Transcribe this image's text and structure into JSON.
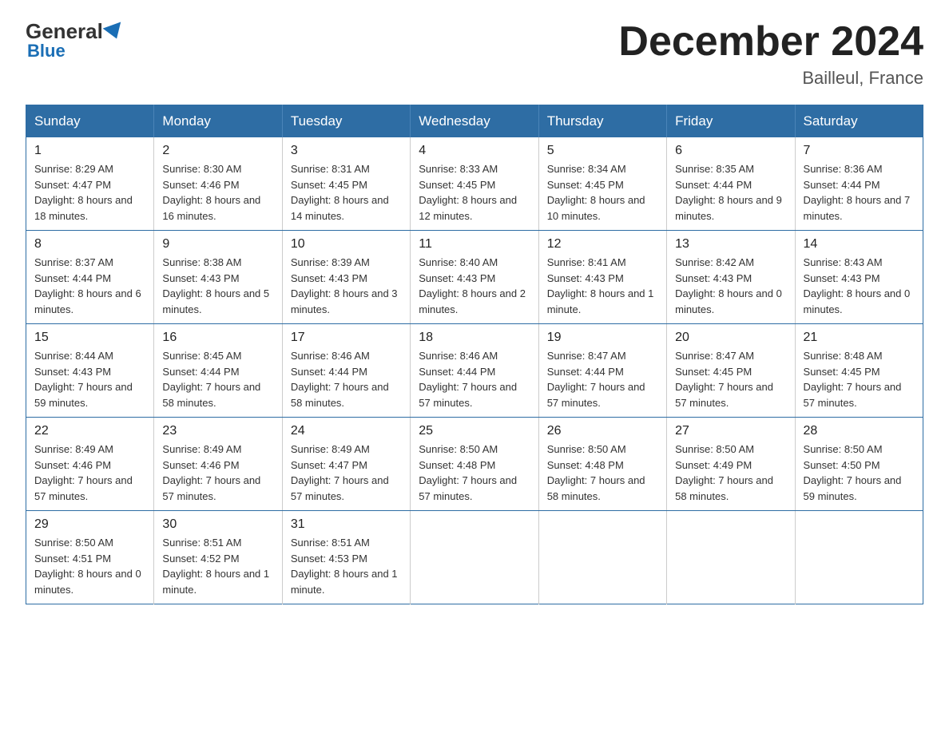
{
  "logo": {
    "general": "General",
    "blue": "Blue"
  },
  "title": "December 2024",
  "location": "Bailleul, France",
  "days_header": [
    "Sunday",
    "Monday",
    "Tuesday",
    "Wednesday",
    "Thursday",
    "Friday",
    "Saturday"
  ],
  "weeks": [
    [
      {
        "day": "1",
        "sunrise": "8:29 AM",
        "sunset": "4:47 PM",
        "daylight": "8 hours and 18 minutes."
      },
      {
        "day": "2",
        "sunrise": "8:30 AM",
        "sunset": "4:46 PM",
        "daylight": "8 hours and 16 minutes."
      },
      {
        "day": "3",
        "sunrise": "8:31 AM",
        "sunset": "4:45 PM",
        "daylight": "8 hours and 14 minutes."
      },
      {
        "day": "4",
        "sunrise": "8:33 AM",
        "sunset": "4:45 PM",
        "daylight": "8 hours and 12 minutes."
      },
      {
        "day": "5",
        "sunrise": "8:34 AM",
        "sunset": "4:45 PM",
        "daylight": "8 hours and 10 minutes."
      },
      {
        "day": "6",
        "sunrise": "8:35 AM",
        "sunset": "4:44 PM",
        "daylight": "8 hours and 9 minutes."
      },
      {
        "day": "7",
        "sunrise": "8:36 AM",
        "sunset": "4:44 PM",
        "daylight": "8 hours and 7 minutes."
      }
    ],
    [
      {
        "day": "8",
        "sunrise": "8:37 AM",
        "sunset": "4:44 PM",
        "daylight": "8 hours and 6 minutes."
      },
      {
        "day": "9",
        "sunrise": "8:38 AM",
        "sunset": "4:43 PM",
        "daylight": "8 hours and 5 minutes."
      },
      {
        "day": "10",
        "sunrise": "8:39 AM",
        "sunset": "4:43 PM",
        "daylight": "8 hours and 3 minutes."
      },
      {
        "day": "11",
        "sunrise": "8:40 AM",
        "sunset": "4:43 PM",
        "daylight": "8 hours and 2 minutes."
      },
      {
        "day": "12",
        "sunrise": "8:41 AM",
        "sunset": "4:43 PM",
        "daylight": "8 hours and 1 minute."
      },
      {
        "day": "13",
        "sunrise": "8:42 AM",
        "sunset": "4:43 PM",
        "daylight": "8 hours and 0 minutes."
      },
      {
        "day": "14",
        "sunrise": "8:43 AM",
        "sunset": "4:43 PM",
        "daylight": "8 hours and 0 minutes."
      }
    ],
    [
      {
        "day": "15",
        "sunrise": "8:44 AM",
        "sunset": "4:43 PM",
        "daylight": "7 hours and 59 minutes."
      },
      {
        "day": "16",
        "sunrise": "8:45 AM",
        "sunset": "4:44 PM",
        "daylight": "7 hours and 58 minutes."
      },
      {
        "day": "17",
        "sunrise": "8:46 AM",
        "sunset": "4:44 PM",
        "daylight": "7 hours and 58 minutes."
      },
      {
        "day": "18",
        "sunrise": "8:46 AM",
        "sunset": "4:44 PM",
        "daylight": "7 hours and 57 minutes."
      },
      {
        "day": "19",
        "sunrise": "8:47 AM",
        "sunset": "4:44 PM",
        "daylight": "7 hours and 57 minutes."
      },
      {
        "day": "20",
        "sunrise": "8:47 AM",
        "sunset": "4:45 PM",
        "daylight": "7 hours and 57 minutes."
      },
      {
        "day": "21",
        "sunrise": "8:48 AM",
        "sunset": "4:45 PM",
        "daylight": "7 hours and 57 minutes."
      }
    ],
    [
      {
        "day": "22",
        "sunrise": "8:49 AM",
        "sunset": "4:46 PM",
        "daylight": "7 hours and 57 minutes."
      },
      {
        "day": "23",
        "sunrise": "8:49 AM",
        "sunset": "4:46 PM",
        "daylight": "7 hours and 57 minutes."
      },
      {
        "day": "24",
        "sunrise": "8:49 AM",
        "sunset": "4:47 PM",
        "daylight": "7 hours and 57 minutes."
      },
      {
        "day": "25",
        "sunrise": "8:50 AM",
        "sunset": "4:48 PM",
        "daylight": "7 hours and 57 minutes."
      },
      {
        "day": "26",
        "sunrise": "8:50 AM",
        "sunset": "4:48 PM",
        "daylight": "7 hours and 58 minutes."
      },
      {
        "day": "27",
        "sunrise": "8:50 AM",
        "sunset": "4:49 PM",
        "daylight": "7 hours and 58 minutes."
      },
      {
        "day": "28",
        "sunrise": "8:50 AM",
        "sunset": "4:50 PM",
        "daylight": "7 hours and 59 minutes."
      }
    ],
    [
      {
        "day": "29",
        "sunrise": "8:50 AM",
        "sunset": "4:51 PM",
        "daylight": "8 hours and 0 minutes."
      },
      {
        "day": "30",
        "sunrise": "8:51 AM",
        "sunset": "4:52 PM",
        "daylight": "8 hours and 1 minute."
      },
      {
        "day": "31",
        "sunrise": "8:51 AM",
        "sunset": "4:53 PM",
        "daylight": "8 hours and 1 minute."
      },
      null,
      null,
      null,
      null
    ]
  ]
}
